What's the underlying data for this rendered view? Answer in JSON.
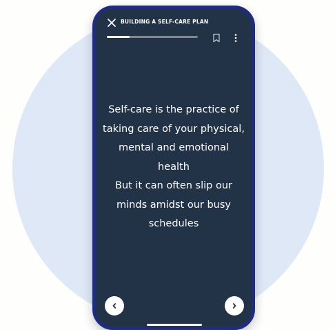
{
  "header": {
    "title": "BUILDING A SELF-CARE PLAN",
    "progress_fraction": 0.25
  },
  "content": {
    "paragraphs": [
      "Self-care is the practice of taking care of your physical, mental and emotional health",
      "But it can often slip our minds amidst our busy schedules"
    ]
  },
  "icons": {
    "close": "close-icon",
    "bookmark": "bookmark-icon",
    "more": "more-vertical-icon",
    "prev": "chevron-left-icon",
    "next": "chevron-right-icon"
  },
  "colors": {
    "screen_background": "#233347",
    "phone_frame": "#1f2d7c",
    "circle_background": "#dfe8f6",
    "text": "#ffffff"
  }
}
